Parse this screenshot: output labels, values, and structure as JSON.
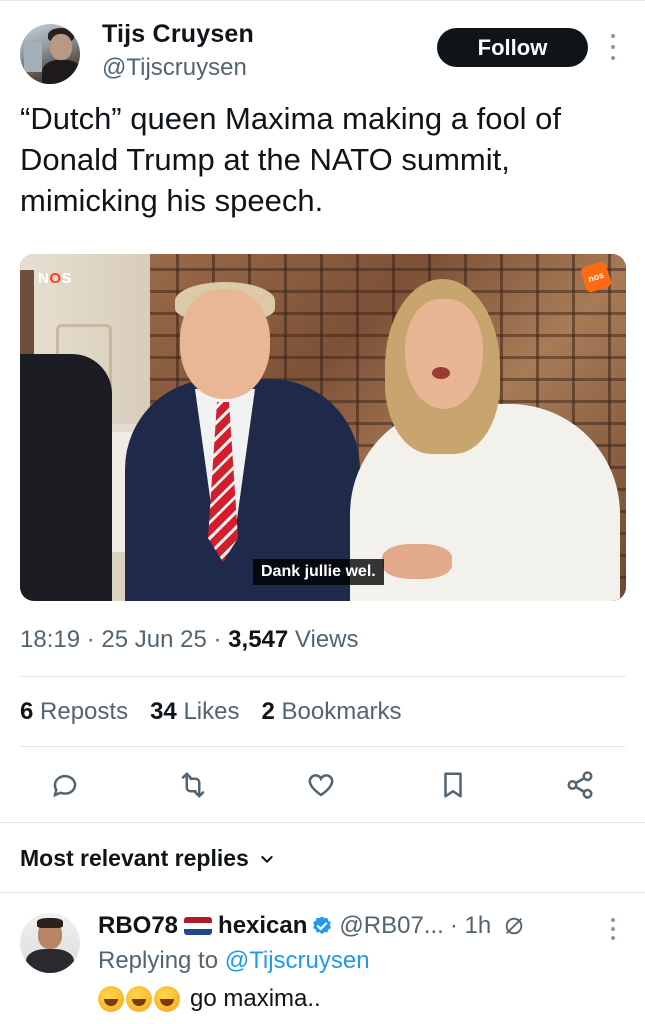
{
  "author": {
    "name": "Tijs Cruysen",
    "handle": "@Tijscruysen",
    "follow_label": "Follow"
  },
  "tweet": {
    "text": "“Dutch” queen Maxima making a fool of Donald Trump at the NATO summit, mimicking his speech.",
    "media": {
      "brand": "NOS",
      "badge": "nos",
      "subtitle": "Dank jullie wel."
    },
    "time": "18:19",
    "date": "25 Jun 25",
    "views_count": "3,547",
    "views_label": "Views",
    "sep": "·"
  },
  "stats": {
    "reposts_count": "6",
    "reposts_label": "Reposts",
    "likes_count": "34",
    "likes_label": "Likes",
    "bookmarks_count": "2",
    "bookmarks_label": "Bookmarks"
  },
  "actions": [
    "reply-icon",
    "repost-icon",
    "like-icon",
    "bookmark-icon",
    "share-icon"
  ],
  "replies": {
    "sort_label": "Most relevant replies",
    "items": [
      {
        "name_part1": "RBO78",
        "name_part2": "hexican",
        "handle": "@RB07...",
        "time": "· 1h",
        "replying_prefix": "Replying to",
        "replying_to": "@Tijscruysen",
        "text": "go maxima.."
      }
    ]
  },
  "colors": {
    "text": "#0f1419",
    "muted": "#536471",
    "link": "#1d9bf0",
    "follow_bg": "#0f1419",
    "verified": "#1d9bf0"
  }
}
